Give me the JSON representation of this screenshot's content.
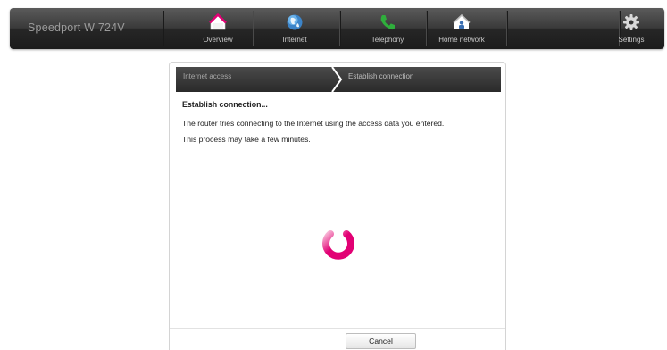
{
  "header": {
    "brand": "Speedport W 724V",
    "nav": [
      {
        "label": "Overview",
        "icon": "home-icon"
      },
      {
        "label": "Internet",
        "icon": "globe-icon"
      },
      {
        "label": "Telephony",
        "icon": "phone-icon"
      },
      {
        "label": "Home network",
        "icon": "home-network-icon"
      }
    ],
    "settings": {
      "label": "Settings",
      "icon": "gear-icon"
    }
  },
  "wizard": {
    "steps": [
      "Internet access",
      "Establish connection"
    ],
    "active_step": 2
  },
  "content": {
    "heading": "Establish connection...",
    "line1": "The router tries connecting to the Internet using the access data you entered.",
    "line2": "This process may take a few minutes."
  },
  "footer": {
    "cancel_label": "Cancel"
  },
  "colors": {
    "accent": "#e20074",
    "nav_bg": "#2a2a2a"
  }
}
